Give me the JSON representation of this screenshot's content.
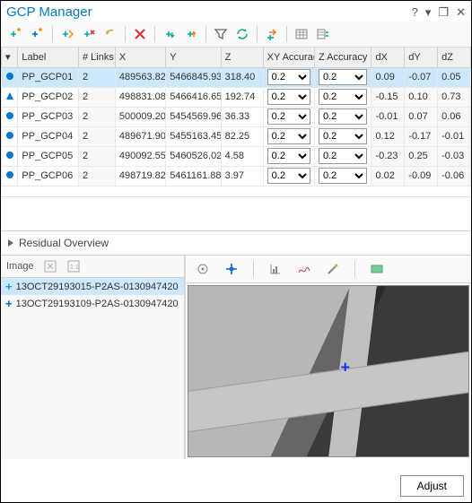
{
  "window": {
    "title": "GCP Manager",
    "help": "?",
    "dropdown": "▾",
    "max": "❐",
    "close": "✕"
  },
  "toolbar": {
    "add": "add-gcp",
    "add2": "add-gcp-alt",
    "recalc": "recompute",
    "delete": "delete",
    "undo": "undo",
    "deleteAll": "delete-all",
    "down": "move-down",
    "up": "move-up",
    "filter": "filter",
    "refresh": "refresh",
    "shift": "shift",
    "table": "toggle-table",
    "sel": "select-by"
  },
  "columns": {
    "c0": "",
    "c1": "Label",
    "c2": "# Links",
    "c3": "X",
    "c4": "Y",
    "c5": "Z",
    "c6": "XY Accuracy",
    "c7": "Z Accuracy",
    "c8": "dX",
    "c9": "dY",
    "c10": "dZ"
  },
  "accOptions": [
    "0.2"
  ],
  "rows": [
    {
      "marker": "dot",
      "label": "PP_GCP01",
      "links": "2",
      "x": "489563.82",
      "y": "5466845.93",
      "z": "318.40",
      "xy": "0.2",
      "za": "0.2",
      "dx": "0.09",
      "dy": "-0.07",
      "dz": "0.05",
      "sel": true
    },
    {
      "marker": "tri",
      "label": "PP_GCP02",
      "links": "2",
      "x": "498831.08",
      "y": "5466416.65",
      "z": "192.74",
      "xy": "0.2",
      "za": "0.2",
      "dx": "-0.15",
      "dy": "0.10",
      "dz": "0.73",
      "sel": false
    },
    {
      "marker": "dot",
      "label": "PP_GCP03",
      "links": "2",
      "x": "500009.20",
      "y": "5454569.96",
      "z": "36.33",
      "xy": "0.2",
      "za": "0.2",
      "dx": "-0.01",
      "dy": "0.07",
      "dz": "0.06",
      "sel": false
    },
    {
      "marker": "dot",
      "label": "PP_GCP04",
      "links": "2",
      "x": "489671.90",
      "y": "5455163.45",
      "z": "82.25",
      "xy": "0.2",
      "za": "0.2",
      "dx": "0.12",
      "dy": "-0.17",
      "dz": "-0.01",
      "sel": false
    },
    {
      "marker": "dot",
      "label": "PP_GCP05",
      "links": "2",
      "x": "490092.55",
      "y": "5460526.02",
      "z": "4.58",
      "xy": "0.2",
      "za": "0.2",
      "dx": "-0.23",
      "dy": "0.25",
      "dz": "-0.03",
      "sel": false
    },
    {
      "marker": "dot",
      "label": "PP_GCP06",
      "links": "2",
      "x": "498719.82",
      "y": "5461161.88",
      "z": "3.97",
      "xy": "0.2",
      "za": "0.2",
      "dx": "0.02",
      "dy": "-0.09",
      "dz": "-0.06",
      "sel": false
    }
  ],
  "residual": {
    "title": "Residual Overview"
  },
  "imagePanel": {
    "title": "Image",
    "icon1": "zoom-extent",
    "icon2": "extent-1-1",
    "items": [
      {
        "name": "13OCT29193015-P2AS-0130947420",
        "sel": true
      },
      {
        "name": "13OCT29193109-P2AS-0130947420",
        "sel": false
      }
    ]
  },
  "viewerToolbar": {
    "target": "target",
    "pan": "pan",
    "chart": "chart",
    "curve": "curve",
    "wand": "wand",
    "swatch": "swatch"
  },
  "adjust": {
    "label": "Adjust"
  }
}
